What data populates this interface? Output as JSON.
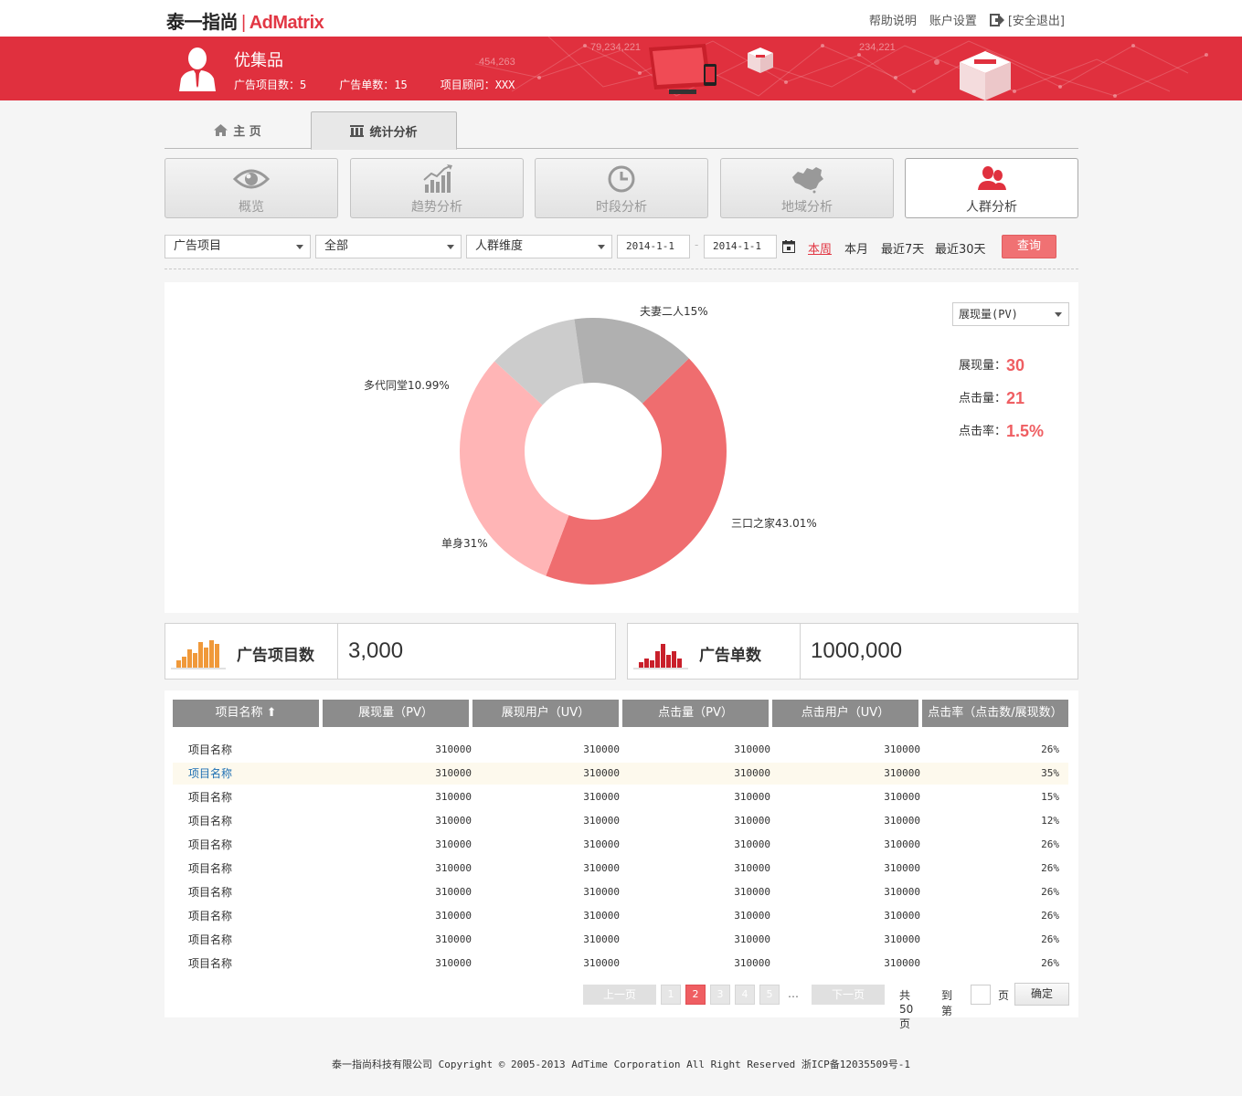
{
  "header": {
    "logo_cn": "泰一指尚",
    "logo_sep": "|",
    "logo_en": "AdMatrix",
    "links": [
      "帮助说明",
      "账户设置",
      "[安全退出]"
    ]
  },
  "banner": {
    "shop_name": "优集品",
    "stats": [
      "广告项目数：5",
      "广告单数：15",
      "项目顾问：XXX"
    ],
    "deco_numbers": [
      "79,234,221",
      "454,263",
      "234,221"
    ]
  },
  "main_tabs": [
    {
      "label": "主  页",
      "icon": "home-icon"
    },
    {
      "label": "统计分析",
      "icon": "chart-icon"
    }
  ],
  "sub_tabs": [
    {
      "label": "概览",
      "icon": "eye-icon"
    },
    {
      "label": "趋势分析",
      "icon": "trend-icon"
    },
    {
      "label": "时段分析",
      "icon": "clock-icon"
    },
    {
      "label": "地域分析",
      "icon": "map-icon"
    },
    {
      "label": "人群分析",
      "icon": "people-icon"
    }
  ],
  "filters": {
    "project": "广告项目",
    "scope": "全部",
    "dimension": "人群维度",
    "date_from": "2014-1-1",
    "date_to": "2014-1-1",
    "dash": "-",
    "quick": [
      "本周",
      "本月",
      "最近7天",
      "最近30天"
    ],
    "query_label": "查询"
  },
  "chart_data": {
    "type": "pie",
    "categories": [
      "三口之家",
      "单身",
      "多代同堂",
      "夫妻二人"
    ],
    "values": [
      43.01,
      31,
      10.99,
      15
    ],
    "labels": [
      "三口之家43.01%",
      "单身31%",
      "多代同堂10.99%",
      "夫妻二人15%"
    ],
    "colors": [
      "#ef6d6f",
      "#ffb5b6",
      "#cccccc",
      "#b0b0b0"
    ],
    "donut": true
  },
  "metrics": {
    "selector": "展现量(PV)",
    "items": [
      {
        "label": "展现量：",
        "value": "30"
      },
      {
        "label": "点击量：",
        "value": "21"
      },
      {
        "label": "点击率：",
        "value": "1.5%"
      }
    ]
  },
  "cards": [
    {
      "label": "广告项目数",
      "value": "3,000",
      "color": "#f0993a"
    },
    {
      "label": "广告单数",
      "value": "1000,000",
      "color": "#c9202b"
    }
  ],
  "table": {
    "headers": [
      "项目名称 ⬆",
      "展现量（PV）",
      "展现用户（UV）",
      "点击量（PV）",
      "点击用户（UV）",
      "点击率（点击数/展现数）"
    ],
    "rows": [
      [
        "项目名称",
        "310000",
        "310000",
        "310000",
        "310000",
        "26%"
      ],
      [
        "项目名称",
        "310000",
        "310000",
        "310000",
        "310000",
        "35%"
      ],
      [
        "项目名称",
        "310000",
        "310000",
        "310000",
        "310000",
        "15%"
      ],
      [
        "项目名称",
        "310000",
        "310000",
        "310000",
        "310000",
        "12%"
      ],
      [
        "项目名称",
        "310000",
        "310000",
        "310000",
        "310000",
        "26%"
      ],
      [
        "项目名称",
        "310000",
        "310000",
        "310000",
        "310000",
        "26%"
      ],
      [
        "项目名称",
        "310000",
        "310000",
        "310000",
        "310000",
        "26%"
      ],
      [
        "项目名称",
        "310000",
        "310000",
        "310000",
        "310000",
        "26%"
      ],
      [
        "项目名称",
        "310000",
        "310000",
        "310000",
        "310000",
        "26%"
      ],
      [
        "项目名称",
        "310000",
        "310000",
        "310000",
        "310000",
        "26%"
      ]
    ]
  },
  "pagination": {
    "prev": "上一页",
    "pages": [
      "1",
      "2",
      "3",
      "4",
      "5"
    ],
    "ellipsis": "…",
    "next": "下一页",
    "total": "共50页",
    "goto": "到第",
    "page_unit": "页",
    "ok": "确定"
  },
  "footer": "泰一指尚科技有限公司 Copyright © 2005-2013 AdTime Corporation All Right Reserved 浙ICP备12035509号-1"
}
